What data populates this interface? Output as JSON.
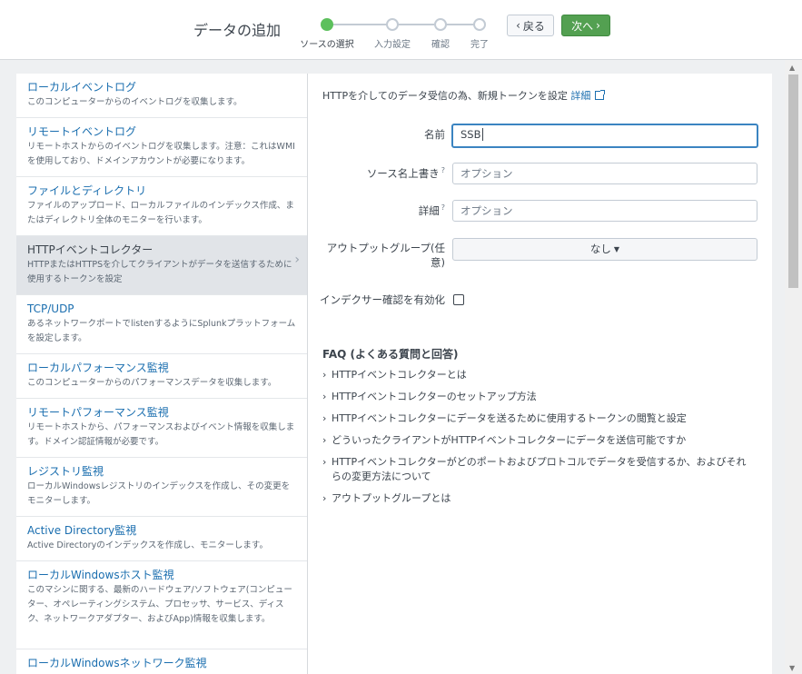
{
  "header": {
    "title": "データの追加",
    "steps": [
      {
        "label": "ソースの選択",
        "active": true
      },
      {
        "label": "入力設定",
        "active": false
      },
      {
        "label": "確認",
        "active": false
      },
      {
        "label": "完了",
        "active": false
      }
    ],
    "back_label": "戻る",
    "next_label": "次へ",
    "back_chevron": "‹",
    "next_chevron": "›"
  },
  "sources": [
    {
      "title": "ローカルイベントログ",
      "desc": "このコンピューターからのイベントログを収集します。"
    },
    {
      "title": "リモートイベントログ",
      "desc": "リモートホストからのイベントログを収集します。注意：これはWMIを使用しており、ドメインアカウントが必要になります。"
    },
    {
      "title": "ファイルとディレクトリ",
      "desc": "ファイルのアップロード、ローカルファイルのインデックス作成、またはディレクトリ全体のモニターを行います。"
    },
    {
      "title": "HTTPイベントコレクター",
      "desc": "HTTPまたはHTTPSを介してクライアントがデータを送信するために使用するトークンを設定",
      "selected": true
    },
    {
      "title": "TCP/UDP",
      "desc": "あるネットワークポートでlistenするようにSplunkプラットフォームを設定します。"
    },
    {
      "title": "ローカルパフォーマンス監視",
      "desc": "このコンピューターからのパフォーマンスデータを収集します。"
    },
    {
      "title": "リモートパフォーマンス監視",
      "desc": "リモートホストから、パフォーマンスおよびイベント情報を収集します。ドメイン認証情報が必要です。"
    },
    {
      "title": "レジストリ監視",
      "desc": "ローカルWindowsレジストリのインデックスを作成し、その変更をモニターします。"
    },
    {
      "title": "Active Directory監視",
      "desc": "Active Directoryのインデックスを作成し、モニターします。"
    },
    {
      "title": "ローカルWindowsホスト監視",
      "desc": "このマシンに関する、最新のハードウェア/ソフトウェア(コンピューター、オペレーティングシステム、プロセッサ、サービス、ディスク、ネットワークアダプター、およびApp)情報を収集します。"
    },
    {
      "title": "ローカルWindowsネットワーク監視",
      "desc": ""
    }
  ],
  "form": {
    "intro": "HTTPを介してのデータ受信の為、新規トークンを設定",
    "intro_link": "詳細",
    "name_label": "名前",
    "name_value": "SSB",
    "source_override_label": "ソース名上書き",
    "source_override_placeholder": "オプション",
    "description_label": "詳細",
    "description_placeholder": "オプション",
    "help_mark": "?",
    "output_group_label": "アウトプットグループ(任意)",
    "output_group_value": "なし",
    "indexer_ack_label": "インデクサー確認を有効化",
    "indexer_ack_checked": false
  },
  "faq": {
    "title": "FAQ (よくある質問と回答)",
    "items": [
      "HTTPイベントコレクターとは",
      "HTTPイベントコレクターのセットアップ方法",
      "HTTPイベントコレクターにデータを送るために使用するトークンの閲覧と設定",
      "どういったクライアントがHTTPイベントコレクターにデータを送信可能ですか",
      "HTTPイベントコレクターがどのポートおよびプロトコルでデータを受信するか、およびそれらの変更方法について",
      "アウトプットグループとは"
    ]
  },
  "colors": {
    "accent_link": "#1a6eaf",
    "next_button": "#53a051",
    "active_step": "#5cc05c"
  }
}
